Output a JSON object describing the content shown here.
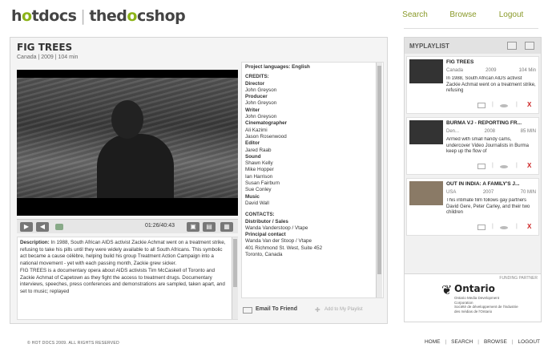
{
  "brand": {
    "logo_left": "hotdocs",
    "logo_right": "thedocshop"
  },
  "topnav": {
    "search": "Search",
    "browse": "Browse",
    "logout": "Logout"
  },
  "film": {
    "title": "FIG TREES",
    "meta": "Canada | 2009 | 104 min",
    "timecode": "01:26/40:43",
    "description_label": "Description:",
    "description_p1": "In 1988, South African AIDS activist Zackie Achmat went on a treatment strike, refusing to take his pills until they were widely available to all South Africans. This symbolic act became a cause célèbre, helping build his group Treatment Action Campaign into a national movement - yet with each passing month, Zackie grew sicker.",
    "description_p2": "FIG TREES is a documentary opera about AIDS activists Tim McCaskell of Toronto and Zackie Achmat of Capetown as they fight the access to treatment drugs. Documentary interviews, speeches, press conferences and demonstrations are sampled, taken apart, and set to music; replayed"
  },
  "credits": {
    "language": "Project languages: English",
    "credits_heading": "CREDITS:",
    "roles": [
      {
        "role": "Director",
        "name": "John Greyson"
      },
      {
        "role": "Producer",
        "name": "John Greyson"
      },
      {
        "role": "Writer",
        "name": "John Greyson"
      },
      {
        "role": "Cinematographer",
        "name": "Ali Kazimi\nJason Rosenwood"
      },
      {
        "role": "Editor",
        "name": "Jared Raab"
      },
      {
        "role": "Sound",
        "name": "Shawn Kelly\nMike Hopper\nIan Harrison\nSusan Fairburn\nSue Conley"
      },
      {
        "role": "Music",
        "name": "David Wall"
      }
    ],
    "contacts_heading": "CONTACTS:",
    "contacts": [
      {
        "role": "Distributor / Sales",
        "name": "Wanda Vanderstoop / Vtape"
      },
      {
        "role": "Principal contact",
        "name": "Wanda Van der Stoop / Vtape\n401 Richmond St. West, Suite 452\nToronto, Canada"
      }
    ]
  },
  "actions": {
    "email": "Email To Friend",
    "add": "Add to My Playlist"
  },
  "playlist": {
    "title": "MYPLAYLIST",
    "items": [
      {
        "title": "FIG TREES",
        "country": "Canada",
        "year": "2009",
        "duration": "104 Min",
        "desc": "In 1988, South African AIDS activist Zackie Achmat went on a treatment strike, refusing"
      },
      {
        "title": "BURMA VJ - REPORTING FR...",
        "country": "Den...",
        "year": "2008",
        "duration": "85 MIN",
        "desc": "Armed with small handy cams, undercover Video Journalists in Burma keep up the flow of"
      },
      {
        "title": "OUT IN INDIA: A FAMILY'S J...",
        "country": "USA",
        "year": "2007",
        "duration": "70 MIN",
        "desc": "This intimate film follows gay partners David Gere, Peter Carley, and their two children"
      }
    ]
  },
  "partner": {
    "label": "FUNDING PARTNER",
    "name": "Ontario",
    "sub": "Ontario Media Development Corporation\nSociété de développement de l'industrie des médias de l'Ontario"
  },
  "footer": {
    "copyright": "© HOT DOCS 2009. ALL RIGHTS RESERVED",
    "links": [
      "HOME",
      "SEARCH",
      "BROWSE",
      "LOGOUT"
    ]
  }
}
